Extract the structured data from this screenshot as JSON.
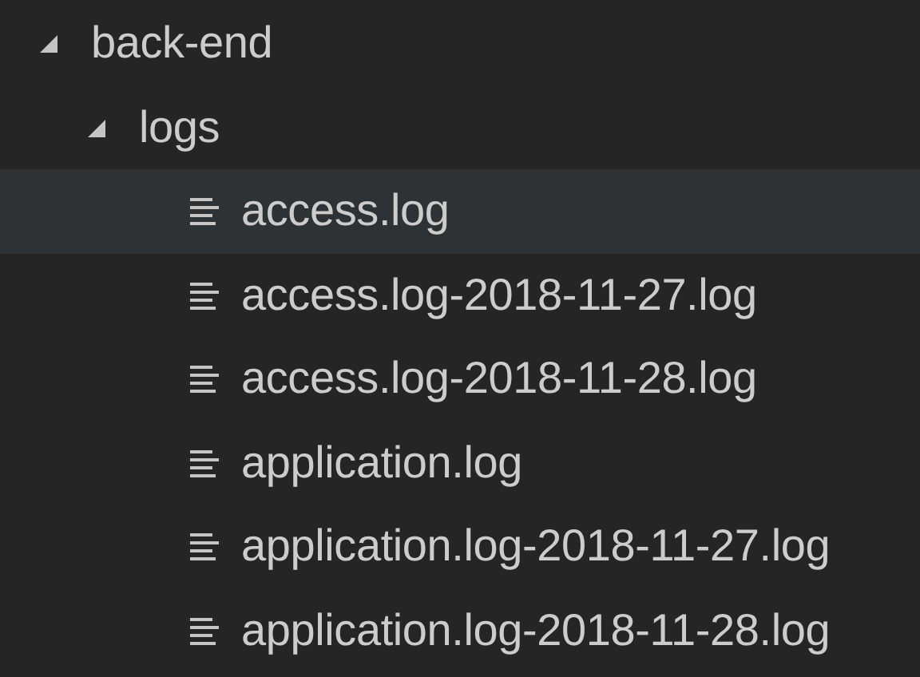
{
  "tree": [
    {
      "label": "back-end",
      "expanded": true,
      "selected": false,
      "children": [
        {
          "label": "logs",
          "expanded": true,
          "selected": false,
          "children": [
            {
              "label": "access.log",
              "selected": true
            },
            {
              "label": "access.log-2018-11-27.log",
              "selected": false
            },
            {
              "label": "access.log-2018-11-28.log",
              "selected": false
            },
            {
              "label": "application.log",
              "selected": false
            },
            {
              "label": "application.log-2018-11-27.log",
              "selected": false
            },
            {
              "label": "application.log-2018-11-28.log",
              "selected": false
            }
          ]
        }
      ]
    }
  ]
}
